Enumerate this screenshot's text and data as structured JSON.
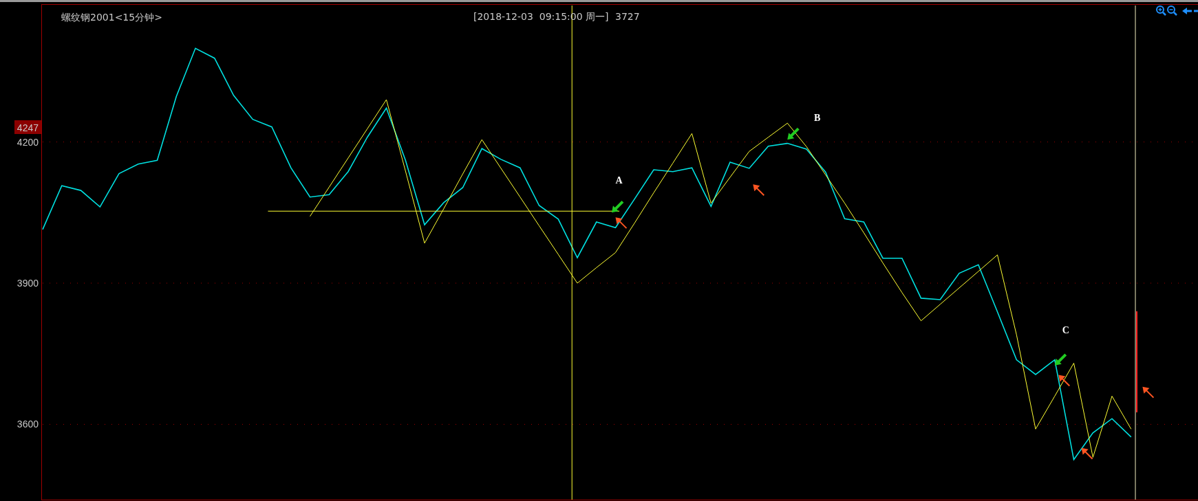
{
  "header": {
    "title": "螺纹钢2001<15分钟>",
    "cursor_time": "[2018-12-03  09:15:00 周一]",
    "cursor_value": "3727"
  },
  "price_marker": "4247",
  "wave_labels": [
    "A",
    "B",
    "C"
  ],
  "chart_data": {
    "type": "line",
    "grid": true,
    "ylim": [
      3440,
      4490
    ],
    "yticks": [
      3600,
      3900,
      4200
    ],
    "categories": [
      null,
      null,
      null,
      null,
      null,
      null,
      null,
      null,
      null,
      null,
      null,
      null,
      null,
      null,
      null,
      null,
      null,
      null,
      null,
      null,
      null,
      null,
      null,
      null,
      null,
      null,
      null,
      null,
      null,
      null,
      null,
      null,
      null,
      null,
      null,
      null,
      null,
      null,
      null,
      null,
      null,
      null,
      null,
      null,
      null,
      null,
      null,
      null,
      null,
      null,
      null,
      null,
      null,
      null,
      null,
      null,
      null,
      null
    ],
    "series": [
      {
        "color": "#00e0e0",
        "values": [
          4014,
          4107,
          4097,
          4062,
          4133,
          4153,
          4161,
          4297,
          4399,
          4378,
          4299,
          4248,
          4232,
          4145,
          4083,
          4088,
          4137,
          4210,
          4272,
          4161,
          4024,
          4071,
          4103,
          4186,
          4163,
          4145,
          4065,
          4036,
          3954,
          4030,
          4018,
          4079,
          4141,
          4137,
          4145,
          4063,
          4157,
          4144,
          4191,
          4197,
          4185,
          4136,
          4037,
          4030,
          3953,
          3953,
          3868,
          3865,
          3921,
          3939,
          3839,
          3737,
          3706,
          3737,
          3525,
          3582,
          3612,
          3573
        ]
      },
      {
        "color": "#ffff33",
        "values": [
          null,
          null,
          null,
          null,
          null,
          null,
          null,
          null,
          null,
          null,
          null,
          null,
          null,
          null,
          4042,
          4104,
          4166,
          4228,
          4290,
          4138,
          3985,
          4058,
          4132,
          4205,
          4144,
          4083,
          4022,
          3961,
          3900,
          3933,
          3965,
          4028,
          4092,
          4155,
          4218,
          4070,
          4125,
          4180,
          4210,
          4240,
          4190,
          4130,
          4070,
          4007,
          3943,
          3880,
          3820,
          3855,
          3890,
          3925,
          3960,
          3790,
          3590,
          3660,
          3730,
          3530,
          3660,
          3590
        ]
      }
    ]
  }
}
